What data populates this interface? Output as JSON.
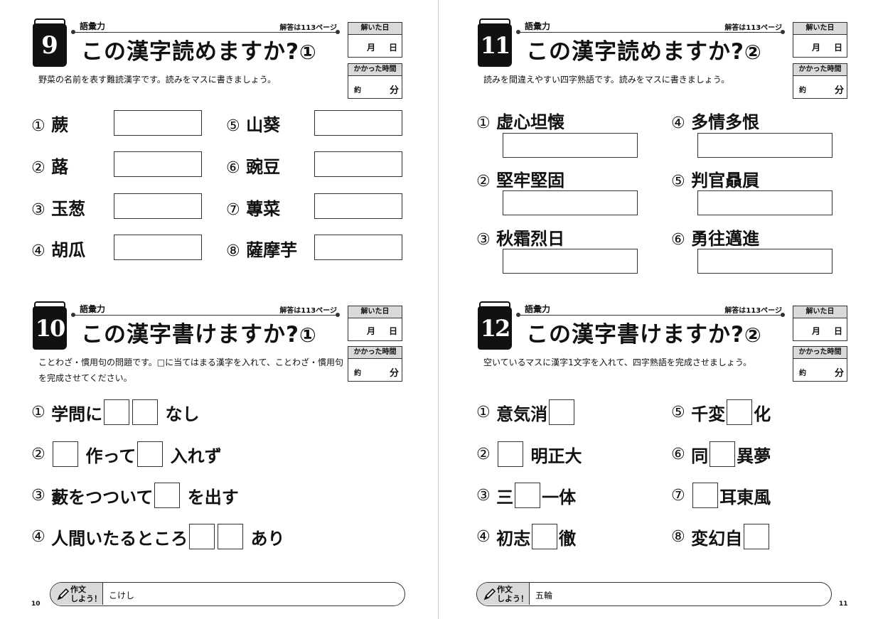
{
  "common": {
    "category": "語彙力",
    "answer_ref": "解答は113ページ",
    "date_label": "解いた日",
    "month": "月",
    "day": "日",
    "time_label": "かかった時間",
    "approx": "約",
    "minutes": "分",
    "compose_label": "作文\nしよう！"
  },
  "s9": {
    "number": "9",
    "title": "この漢字読めますか?",
    "title_mark": "①",
    "instruction": "野菜の名前を表す難読漢字です。読みをマスに書きましょう。",
    "items": [
      {
        "n": "①",
        "text": "蕨"
      },
      {
        "n": "②",
        "text": "蕗"
      },
      {
        "n": "③",
        "text": "玉葱"
      },
      {
        "n": "④",
        "text": "胡瓜"
      },
      {
        "n": "⑤",
        "text": "山葵"
      },
      {
        "n": "⑥",
        "text": "豌豆"
      },
      {
        "n": "⑦",
        "text": "蓴菜"
      },
      {
        "n": "⑧",
        "text": "薩摩芋"
      }
    ]
  },
  "s10": {
    "number": "10",
    "title": "この漢字書けますか?",
    "title_mark": "①",
    "instruction": "ことわざ・慣用句の問題です。□に当てはまる漢字を入れて、ことわざ・慣用句を完成させてください。",
    "items": [
      {
        "n": "①",
        "pre": "学問に",
        "post": "なし"
      },
      {
        "n": "②",
        "mid": "作って",
        "post": "入れず"
      },
      {
        "n": "③",
        "pre": "藪をつついて",
        "post": "を出す"
      },
      {
        "n": "④",
        "pre": "人間いたるところ",
        "post": "あり"
      }
    ]
  },
  "s11": {
    "number": "11",
    "title": "この漢字読めますか?",
    "title_mark": "②",
    "instruction": "読みを間違えやすい四字熟語です。読みをマスに書きましょう。",
    "items": [
      {
        "n": "①",
        "text": "虚心坦懐"
      },
      {
        "n": "②",
        "text": "堅牢堅固"
      },
      {
        "n": "③",
        "text": "秋霜烈日"
      },
      {
        "n": "④",
        "text": "多情多恨"
      },
      {
        "n": "⑤",
        "text": "判官贔屓"
      },
      {
        "n": "⑥",
        "text": "勇往邁進"
      }
    ]
  },
  "s12": {
    "number": "12",
    "title": "この漢字書けますか?",
    "title_mark": "②",
    "instruction": "空いているマスに漢字1文字を入れて、四字熟語を完成させましょう。",
    "items": [
      {
        "n": "①",
        "a": "意気消",
        "b": ""
      },
      {
        "n": "②",
        "a": "",
        "b": "明正大"
      },
      {
        "n": "③",
        "a": "三",
        "b": "一体"
      },
      {
        "n": "④",
        "a": "初志",
        "b": "徹"
      },
      {
        "n": "⑤",
        "a": "千変",
        "b": "化"
      },
      {
        "n": "⑥",
        "a": "同",
        "b": "異夢"
      },
      {
        "n": "⑦",
        "a": "",
        "b": "耳東風"
      },
      {
        "n": "⑧",
        "a": "変幻自",
        "b": ""
      }
    ]
  },
  "footer_left": {
    "text": "こけし",
    "page": "10"
  },
  "footer_right": {
    "text": "五輪",
    "page": "11"
  }
}
